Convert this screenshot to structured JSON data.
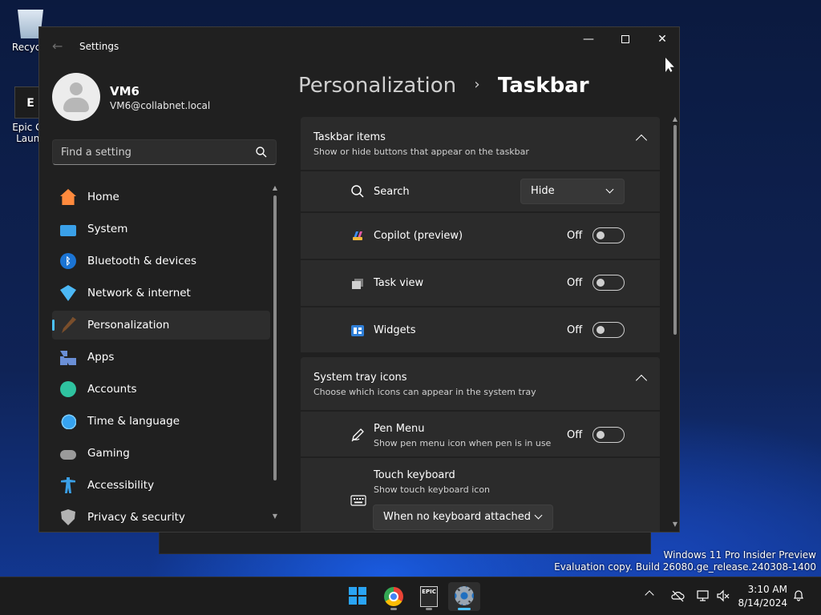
{
  "desktop": {
    "icons": [
      {
        "label": "Recycle",
        "icon": "recycle-bin-icon"
      },
      {
        "label": "Epic Ga Launc",
        "label_line1": "Epic Ga",
        "label_line2": "Launc",
        "icon": "epic-games-icon"
      }
    ]
  },
  "window": {
    "title": "Settings",
    "controls": {
      "minimize": "—",
      "close": "✕"
    }
  },
  "user": {
    "name": "VM6",
    "email": "VM6@collabnet.local"
  },
  "search": {
    "placeholder": "Find a setting"
  },
  "sidebar": {
    "items": [
      {
        "label": "Home",
        "icon": "home-icon",
        "active": false
      },
      {
        "label": "System",
        "icon": "system-icon",
        "active": false
      },
      {
        "label": "Bluetooth & devices",
        "icon": "bluetooth-icon",
        "active": false
      },
      {
        "label": "Network & internet",
        "icon": "network-icon",
        "active": false
      },
      {
        "label": "Personalization",
        "icon": "personalization-icon",
        "active": true
      },
      {
        "label": "Apps",
        "icon": "apps-icon",
        "active": false
      },
      {
        "label": "Accounts",
        "icon": "accounts-icon",
        "active": false
      },
      {
        "label": "Time & language",
        "icon": "time-language-icon",
        "active": false
      },
      {
        "label": "Gaming",
        "icon": "gaming-icon",
        "active": false
      },
      {
        "label": "Accessibility",
        "icon": "accessibility-icon",
        "active": false
      },
      {
        "label": "Privacy & security",
        "icon": "privacy-icon",
        "active": false
      }
    ]
  },
  "breadcrumb": {
    "parent": "Personalization",
    "separator": "›",
    "current": "Taskbar"
  },
  "taskbar_items": {
    "title": "Taskbar items",
    "subtitle": "Show or hide buttons that appear on the taskbar",
    "search": {
      "label": "Search",
      "value": "Hide"
    },
    "copilot": {
      "label": "Copilot (preview)",
      "state": "Off"
    },
    "task_view": {
      "label": "Task view",
      "state": "Off"
    },
    "widgets": {
      "label": "Widgets",
      "state": "Off"
    }
  },
  "system_tray": {
    "title": "System tray icons",
    "subtitle": "Choose which icons can appear in the system tray",
    "pen_menu": {
      "label": "Pen Menu",
      "subtitle": "Show pen menu icon when pen is in use",
      "state": "Off"
    },
    "touch_keyboard": {
      "label": "Touch keyboard",
      "subtitle": "Show touch keyboard icon",
      "value": "When no keyboard attached"
    }
  },
  "watermark": {
    "line1": "Windows 11 Pro Insider Preview",
    "line2": "Evaluation copy. Build 26080.ge_release.240308-1400"
  },
  "taskbar": {
    "apps": [
      {
        "name": "start",
        "icon": "windows-start-icon"
      },
      {
        "name": "chrome",
        "icon": "chrome-icon"
      },
      {
        "name": "epic",
        "icon": "epic-games-icon",
        "label": "EPIC"
      },
      {
        "name": "settings",
        "icon": "settings-gear-icon"
      }
    ],
    "time": "3:10 AM",
    "date": "8/14/2024"
  },
  "colors": {
    "accent": "#4cc2ff",
    "window_bg": "#202020",
    "card_bg": "#2b2b2b"
  }
}
